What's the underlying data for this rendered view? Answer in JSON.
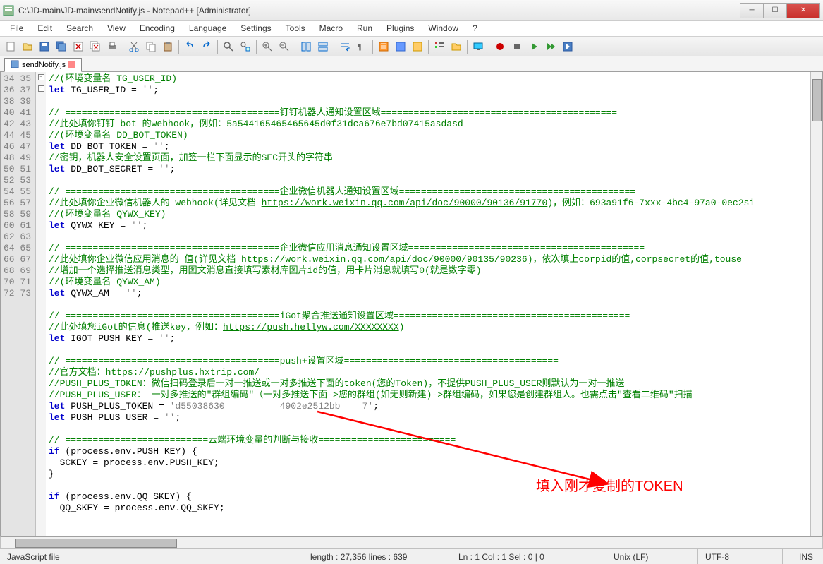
{
  "window": {
    "title": "C:\\JD-main\\JD-main\\sendNotify.js - Notepad++ [Administrator]"
  },
  "menus": [
    "File",
    "Edit",
    "Search",
    "View",
    "Encoding",
    "Language",
    "Settings",
    "Tools",
    "Macro",
    "Run",
    "Plugins",
    "Window",
    "?"
  ],
  "tab": {
    "label": "sendNotify.js"
  },
  "lines": {
    "start": 34,
    "end": 73,
    "fold": {
      "67": "-",
      "71": "-"
    },
    "code": [
      "//(环境变量名 TG_USER_ID)",
      "let TG_USER_ID = '';",
      "",
      "// =======================================钉钉机器人通知设置区域===========================================",
      "//此处填你钉钉 bot 的webhook，例如：5a544165465465645d0f31dca676e7bd07415asdasd",
      "//(环境变量名 DD_BOT_TOKEN)",
      "let DD_BOT_TOKEN = '';",
      "//密钥，机器人安全设置页面，加签一栏下面显示的SEC开头的字符串",
      "let DD_BOT_SECRET = '';",
      "",
      "// =======================================企业微信机器人通知设置区域===========================================",
      "//此处填你企业微信机器人的 webhook(详见文档 https://work.weixin.qq.com/api/doc/90000/90136/91770)，例如：693a91f6-7xxx-4bc4-97a0-0ec2si",
      "//(环境变量名 QYWX_KEY)",
      "let QYWX_KEY = '';",
      "",
      "// =======================================企业微信应用消息通知设置区域===========================================",
      "//此处填你企业微信应用消息的 值(详见文档 https://work.weixin.qq.com/api/doc/90000/90135/90236)，依次填上corpid的值,corpsecret的值,touse",
      "//增加一个选择推送消息类型，用图文消息直接填写素材库图片id的值，用卡片消息就填写0(就是数字零)",
      "//(环境变量名 QYWX_AM)",
      "let QYWX_AM = '';",
      "",
      "// =======================================iGot聚合推送通知设置区域===========================================",
      "//此处填您iGot的信息(推送key，例如：https://push.hellyw.com/XXXXXXXX)",
      "let IGOT_PUSH_KEY = '';",
      "",
      "// =======================================push+设置区域=======================================",
      "//官方文档：https://pushplus.hxtrip.com/",
      "//PUSH_PLUS_TOKEN：微信扫码登录后一对一推送或一对多推送下面的token(您的Token)，不提供PUSH_PLUS_USER则默认为一对一推送",
      "//PUSH_PLUS_USER： 一对多推送的\"群组编码\"（一对多推送下面->您的群组(如无则新建)->群组编码，如果您是创建群组人。也需点击\"查看二维码\"扫描",
      "let PUSH_PLUS_TOKEN = 'd55038630          4902e2512bb    7';",
      "let PUSH_PLUS_USER = '';",
      "",
      "// ==========================云端环境变量的判断与接收=========================",
      "if (process.env.PUSH_KEY) {",
      "  SCKEY = process.env.PUSH_KEY;",
      "}",
      "",
      "if (process.env.QQ_SKEY) {",
      "  QQ_SKEY = process.env.QQ_SKEY;",
      ""
    ]
  },
  "status": {
    "lang": "JavaScript file",
    "length": "length : 27,356    lines : 639",
    "pos": "Ln : 1    Col : 1    Sel : 0 | 0",
    "eol": "Unix (LF)",
    "enc": "UTF-8",
    "ins": "INS"
  },
  "annotation": "填入刚才复制的TOKEN"
}
